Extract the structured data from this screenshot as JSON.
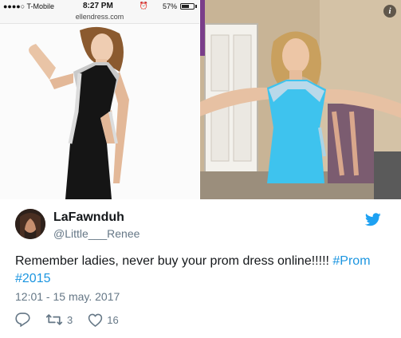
{
  "phone_screenshot": {
    "carrier": "●●●●○ T-Mobile",
    "time": "8:27 PM",
    "battery": "57%",
    "url": "ellendress.com"
  },
  "tweet": {
    "display_name": "LaFawnduh",
    "handle": "@Little___Renee",
    "text_main": "Remember ladies, never buy your prom dress online!!!!! ",
    "hashtag_1": "#Prom",
    "hashtag_2": "#2015",
    "timestamp": "12:01 - 15 may. 2017",
    "retweet_count": "3",
    "like_count": "16"
  },
  "icons": {
    "reply": "reply-icon",
    "retweet": "retweet-icon",
    "like": "heart-icon",
    "brand": "twitter-bird-icon",
    "info": "info-icon"
  },
  "colors": {
    "link": "#1b95e0",
    "secondary_text": "#657786",
    "brand_blue": "#1da1f2",
    "dress_blue": "#3ec3ee"
  }
}
